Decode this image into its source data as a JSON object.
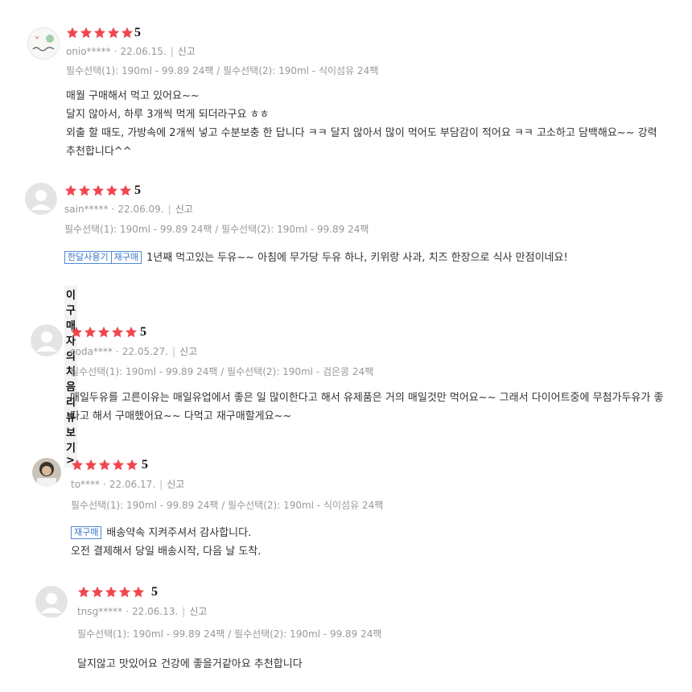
{
  "colors": {
    "star": "#f1464f",
    "tag_border": "#4f8ad6",
    "muted": "#999999"
  },
  "icons": {
    "star": "star-icon",
    "avatar_default": "default-user-icon",
    "chevron": "chevron-right-icon"
  },
  "reviews": [
    {
      "rating": 5,
      "score_text": "5",
      "user": "onio*****",
      "date": "22.06.15.",
      "report": "신고",
      "option": "필수선택(1): 190ml - 99.89 24팩 / 필수선택(2): 190ml - 식이섬유 24팩",
      "tags": [],
      "lines": [
        "매월 구매해서 먹고 있어요~~",
        "달지 않아서, 하루 3개씩 먹게 되더라구요 ㅎㅎ",
        "외출 할 때도, 가방속에 2개씩 넣고 수분보충 한 답니다 ㅋㅋ  달지 않아서 많이 먹어도 부담감이 적어요 ㅋㅋ 고소하고 담백해요~~ 강력추천합니다^^"
      ]
    },
    {
      "rating": 5,
      "score_text": "5",
      "user": "sain*****",
      "date": "22.06.09.",
      "report": "신고",
      "option": "필수선택(1): 190ml - 99.89 24팩 / 필수선택(2): 190ml - 99.89 24팩",
      "tags": [
        "한달사용기",
        "재구매"
      ],
      "lines": [
        "1년째 먹고있는 두유~~ 아침에 무가당 두유 하나, 키위랑 사과, 치즈 한장으로 식사 만점이네요!"
      ],
      "first_review_link": "이 구매자의 처음 리뷰보기>"
    },
    {
      "rating": 5,
      "score_text": "5",
      "user": "coda****",
      "date": "22.05.27.",
      "report": "신고",
      "option": "필수선택(1): 190ml - 99.89 24팩 / 필수선택(2): 190ml - 검은콩 24팩",
      "tags": [],
      "lines": [
        "매일두유를 고른이유는 매일유업에서 좋은 일 많이한다고 해서 유제품은 거의 매일것만 먹어요~~ 그래서 다이어트중에 무첨가두유가 좋다고 해서 구매했어요~~ 다먹고 재구매할게요~~"
      ]
    },
    {
      "rating": 5,
      "score_text": "5",
      "user": "to****",
      "date": "22.06.17.",
      "report": "신고",
      "option": "필수선택(1): 190ml - 99.89 24팩 / 필수선택(2): 190ml - 식이섬유 24팩",
      "tags": [
        "재구매"
      ],
      "lines": [
        "배송약속 지켜주셔서 감사합니다.",
        "오전 결제해서 당일 배송시작, 다음 날 도착."
      ]
    },
    {
      "rating": 5,
      "score_text": "5",
      "user": "tnsg*****",
      "date": "22.06.13.",
      "report": "신고",
      "option": "필수선택(1): 190ml - 99.89 24팩 / 필수선택(2): 190ml - 99.89 24팩",
      "tags": [],
      "lines": [
        "달지않고 맛있어요 건강에 좋을거같아요 추천합니다"
      ]
    }
  ]
}
